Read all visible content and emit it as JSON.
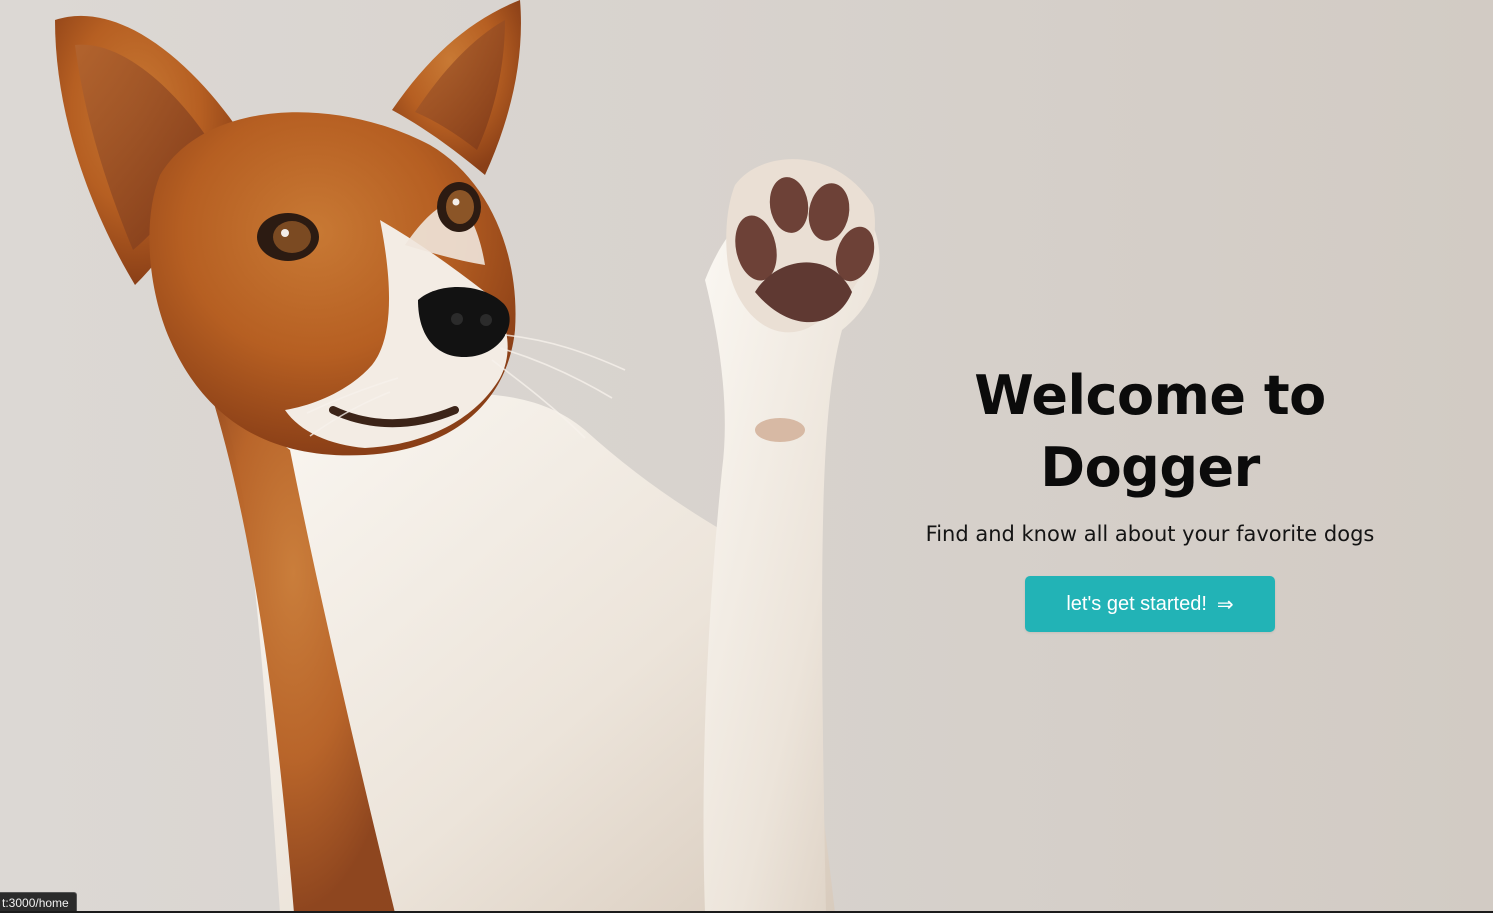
{
  "hero": {
    "title": "Welcome to Dogger",
    "subtitle": "Find and know all about your favorite dogs",
    "cta_label": "let's get started!",
    "cta_arrow": "⇒"
  },
  "status_bar": {
    "url": "t:3000/home"
  },
  "colors": {
    "background": "#d8d3ce",
    "accent": "#22b3b6",
    "title_text": "#0b0b0b",
    "dog_fur_brown": "#b35f22",
    "dog_fur_white": "#f4eee6"
  },
  "icons": {
    "cta_arrow_icon": "double-right-arrow"
  }
}
